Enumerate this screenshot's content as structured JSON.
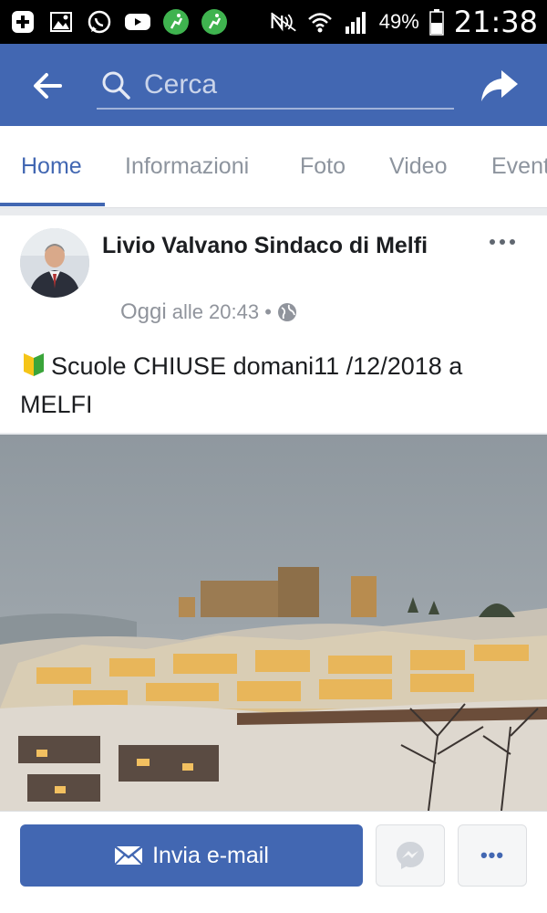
{
  "status_bar": {
    "battery": "49%",
    "time": "21:38",
    "left_icons": [
      "add-notification-icon",
      "gallery-icon",
      "whatsapp-icon",
      "youtube-icon",
      "app-runner-icon",
      "app-runner-icon"
    ],
    "right_icons": [
      "nfc-mute-icon",
      "wifi-icon",
      "signal-icon",
      "battery-icon"
    ]
  },
  "header": {
    "search_placeholder": "Cerca",
    "color": "#4267b2"
  },
  "tabs": [
    {
      "label": "Home",
      "active": true
    },
    {
      "label": "Informazioni"
    },
    {
      "label": "Foto"
    },
    {
      "label": "Video"
    },
    {
      "label": "Eventi"
    }
  ],
  "post": {
    "author": "Livio Valvano Sindaco di Melfi",
    "time_day": "Oggi",
    "time_rest": "alle 20:43 •",
    "audience_icon": "globe-icon",
    "text": "Scuole CHIUSE domani11 /12/2018 a MELFI",
    "leading_emoji": "beginner-flag-icon"
  },
  "actions": {
    "email_label": "Invia e-mail",
    "more_label": "•••"
  }
}
